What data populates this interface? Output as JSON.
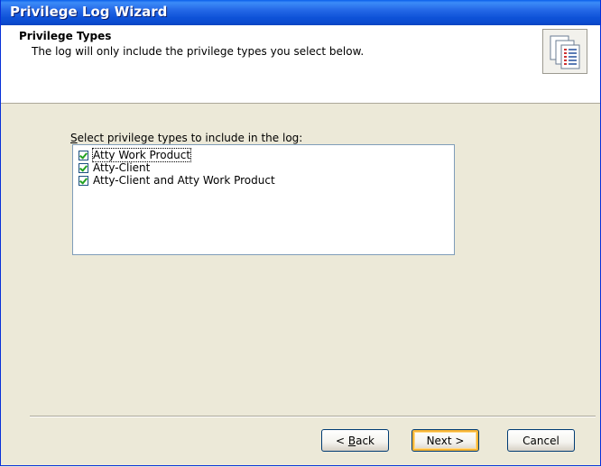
{
  "window": {
    "title": "Privilege Log Wizard"
  },
  "header": {
    "title": "Privilege Types",
    "subtitle": "The log will only include the privilege types you select below.",
    "icon": "document-stack-icon"
  },
  "content": {
    "label_access_key": "S",
    "label_rest": "elect privilege types to include in the log:",
    "items": [
      {
        "label": "Atty Work Product",
        "checked": true
      },
      {
        "label": "Atty-Client",
        "checked": true
      },
      {
        "label": "Atty-Client and Atty Work Product",
        "checked": true
      }
    ]
  },
  "buttons": {
    "back_prefix": "< ",
    "back_key": "B",
    "back_rest": "ack",
    "next": "Next >",
    "cancel": "Cancel"
  }
}
